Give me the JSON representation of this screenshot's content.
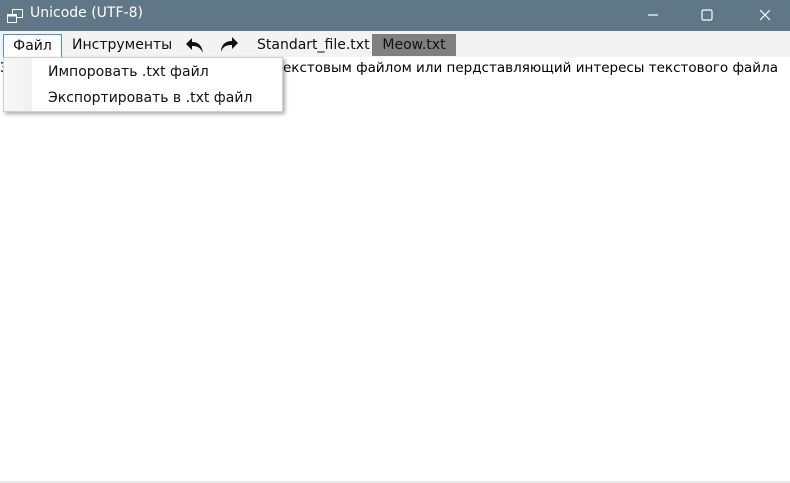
{
  "window": {
    "title": "Unicode (UTF-8)",
    "titlebar_color": "#5f7786",
    "icons": {
      "app": "app-window-icon",
      "minimize": "minimize-icon",
      "maximize": "maximize-icon",
      "close": "close-icon"
    }
  },
  "menubar": {
    "file_label": "Файл",
    "tools_label": "Инструменты",
    "undo_icon": "undo-icon",
    "redo_icon": "redo-icon",
    "tabs": [
      {
        "label": "Standart_file.txt",
        "active": false
      },
      {
        "label": "Meow.txt",
        "active": true
      }
    ],
    "active_tab_color": "#808080"
  },
  "file_menu": {
    "items": [
      {
        "label": "Импоровать .txt файл"
      },
      {
        "label": "Экспортировать в .txt файл"
      }
    ]
  },
  "editor": {
    "visible_prefix": "З",
    "visible_text": "екстовым файлом или пердставляющий интересы текстового файла"
  }
}
